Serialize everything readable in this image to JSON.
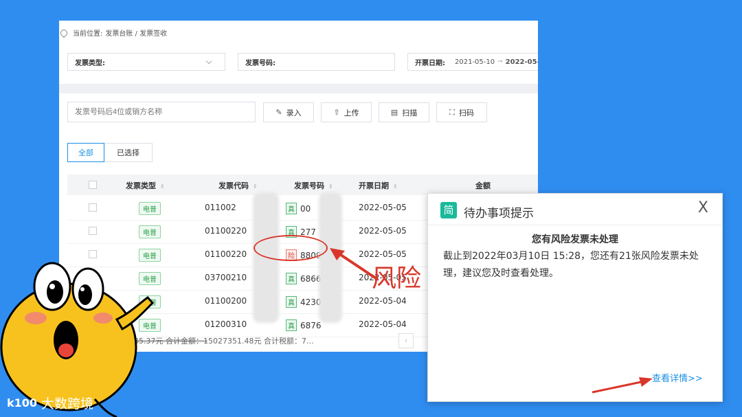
{
  "breadcrumb": {
    "prefix": "当前位置:",
    "path": "发票台账 / 发票签收"
  },
  "filters": {
    "type_label": "发票类型:",
    "number_label": "发票号码:",
    "date_label": "开票日期:",
    "date_start": "2021-05-10",
    "date_sep": "→",
    "date_end": "2022-05-"
  },
  "search": {
    "placeholder": "发票号码后4位或销方名称"
  },
  "toolbar": {
    "enter": "录入",
    "upload": "上传",
    "scan": "扫描",
    "scan_code": "扫码"
  },
  "tabs": {
    "all": "全部",
    "selected": "已选择"
  },
  "table": {
    "headers": {
      "type": "发票类型",
      "code": "发票代码",
      "number": "发票号码",
      "date": "开票日期",
      "amount": "金额"
    },
    "rows": [
      {
        "type": "电普",
        "code": "011002",
        "badge": "真",
        "number": "00",
        "date": "2022-05-05"
      },
      {
        "type": "电普",
        "code": "01100220",
        "badge": "真",
        "number": "277",
        "date": "2022-05-05"
      },
      {
        "type": "电普",
        "code": "01100220",
        "badge": "险",
        "number": "8809",
        "date": "2022-05-05"
      },
      {
        "type": "电普",
        "code": "03700210",
        "badge": "真",
        "number": "6866",
        "date": "2022-05-05"
      },
      {
        "type": "增普",
        "code": "01100200",
        "badge": "真",
        "number": "42301",
        "date": "2022-05-04"
      },
      {
        "type": "电普",
        "code": "01200310",
        "badge": "真",
        "number": "6876",
        "date": "2022-05-04"
      }
    ],
    "footer": "价税合计：15744385.37元 合计金额：15027351.48元 合计税额：7..."
  },
  "pagination": {
    "prev": "‹"
  },
  "annotation": {
    "risk_label": "风险"
  },
  "dialog": {
    "logo": "简",
    "title": "待办事项提示",
    "close": "X",
    "heading": "您有风险发票未处理",
    "body": "截止到2022年03月10日 15:28，您还有21张风险发票未处理，建议您及时查看处理。",
    "link": "查看详情>>"
  },
  "watermark": {
    "logo": "k100",
    "text": "大数跨境"
  },
  "colors": {
    "background": "#2f8df0",
    "accent": "#1a8fe6",
    "risk": "#d9372b",
    "tag_green": "#2e9f4d"
  }
}
